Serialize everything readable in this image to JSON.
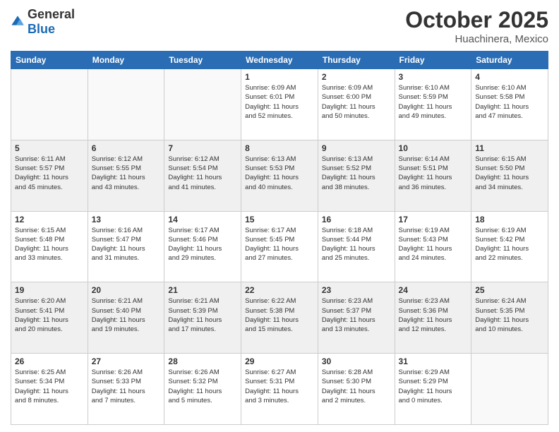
{
  "logo": {
    "general": "General",
    "blue": "Blue"
  },
  "header": {
    "month": "October 2025",
    "location": "Huachinera, Mexico"
  },
  "weekdays": [
    "Sunday",
    "Monday",
    "Tuesday",
    "Wednesday",
    "Thursday",
    "Friday",
    "Saturday"
  ],
  "weeks": [
    [
      {
        "day": "",
        "info": ""
      },
      {
        "day": "",
        "info": ""
      },
      {
        "day": "",
        "info": ""
      },
      {
        "day": "1",
        "info": "Sunrise: 6:09 AM\nSunset: 6:01 PM\nDaylight: 11 hours\nand 52 minutes."
      },
      {
        "day": "2",
        "info": "Sunrise: 6:09 AM\nSunset: 6:00 PM\nDaylight: 11 hours\nand 50 minutes."
      },
      {
        "day": "3",
        "info": "Sunrise: 6:10 AM\nSunset: 5:59 PM\nDaylight: 11 hours\nand 49 minutes."
      },
      {
        "day": "4",
        "info": "Sunrise: 6:10 AM\nSunset: 5:58 PM\nDaylight: 11 hours\nand 47 minutes."
      }
    ],
    [
      {
        "day": "5",
        "info": "Sunrise: 6:11 AM\nSunset: 5:57 PM\nDaylight: 11 hours\nand 45 minutes."
      },
      {
        "day": "6",
        "info": "Sunrise: 6:12 AM\nSunset: 5:55 PM\nDaylight: 11 hours\nand 43 minutes."
      },
      {
        "day": "7",
        "info": "Sunrise: 6:12 AM\nSunset: 5:54 PM\nDaylight: 11 hours\nand 41 minutes."
      },
      {
        "day": "8",
        "info": "Sunrise: 6:13 AM\nSunset: 5:53 PM\nDaylight: 11 hours\nand 40 minutes."
      },
      {
        "day": "9",
        "info": "Sunrise: 6:13 AM\nSunset: 5:52 PM\nDaylight: 11 hours\nand 38 minutes."
      },
      {
        "day": "10",
        "info": "Sunrise: 6:14 AM\nSunset: 5:51 PM\nDaylight: 11 hours\nand 36 minutes."
      },
      {
        "day": "11",
        "info": "Sunrise: 6:15 AM\nSunset: 5:50 PM\nDaylight: 11 hours\nand 34 minutes."
      }
    ],
    [
      {
        "day": "12",
        "info": "Sunrise: 6:15 AM\nSunset: 5:48 PM\nDaylight: 11 hours\nand 33 minutes."
      },
      {
        "day": "13",
        "info": "Sunrise: 6:16 AM\nSunset: 5:47 PM\nDaylight: 11 hours\nand 31 minutes."
      },
      {
        "day": "14",
        "info": "Sunrise: 6:17 AM\nSunset: 5:46 PM\nDaylight: 11 hours\nand 29 minutes."
      },
      {
        "day": "15",
        "info": "Sunrise: 6:17 AM\nSunset: 5:45 PM\nDaylight: 11 hours\nand 27 minutes."
      },
      {
        "day": "16",
        "info": "Sunrise: 6:18 AM\nSunset: 5:44 PM\nDaylight: 11 hours\nand 25 minutes."
      },
      {
        "day": "17",
        "info": "Sunrise: 6:19 AM\nSunset: 5:43 PM\nDaylight: 11 hours\nand 24 minutes."
      },
      {
        "day": "18",
        "info": "Sunrise: 6:19 AM\nSunset: 5:42 PM\nDaylight: 11 hours\nand 22 minutes."
      }
    ],
    [
      {
        "day": "19",
        "info": "Sunrise: 6:20 AM\nSunset: 5:41 PM\nDaylight: 11 hours\nand 20 minutes."
      },
      {
        "day": "20",
        "info": "Sunrise: 6:21 AM\nSunset: 5:40 PM\nDaylight: 11 hours\nand 19 minutes."
      },
      {
        "day": "21",
        "info": "Sunrise: 6:21 AM\nSunset: 5:39 PM\nDaylight: 11 hours\nand 17 minutes."
      },
      {
        "day": "22",
        "info": "Sunrise: 6:22 AM\nSunset: 5:38 PM\nDaylight: 11 hours\nand 15 minutes."
      },
      {
        "day": "23",
        "info": "Sunrise: 6:23 AM\nSunset: 5:37 PM\nDaylight: 11 hours\nand 13 minutes."
      },
      {
        "day": "24",
        "info": "Sunrise: 6:23 AM\nSunset: 5:36 PM\nDaylight: 11 hours\nand 12 minutes."
      },
      {
        "day": "25",
        "info": "Sunrise: 6:24 AM\nSunset: 5:35 PM\nDaylight: 11 hours\nand 10 minutes."
      }
    ],
    [
      {
        "day": "26",
        "info": "Sunrise: 6:25 AM\nSunset: 5:34 PM\nDaylight: 11 hours\nand 8 minutes."
      },
      {
        "day": "27",
        "info": "Sunrise: 6:26 AM\nSunset: 5:33 PM\nDaylight: 11 hours\nand 7 minutes."
      },
      {
        "day": "28",
        "info": "Sunrise: 6:26 AM\nSunset: 5:32 PM\nDaylight: 11 hours\nand 5 minutes."
      },
      {
        "day": "29",
        "info": "Sunrise: 6:27 AM\nSunset: 5:31 PM\nDaylight: 11 hours\nand 3 minutes."
      },
      {
        "day": "30",
        "info": "Sunrise: 6:28 AM\nSunset: 5:30 PM\nDaylight: 11 hours\nand 2 minutes."
      },
      {
        "day": "31",
        "info": "Sunrise: 6:29 AM\nSunset: 5:29 PM\nDaylight: 11 hours\nand 0 minutes."
      },
      {
        "day": "",
        "info": ""
      }
    ]
  ]
}
